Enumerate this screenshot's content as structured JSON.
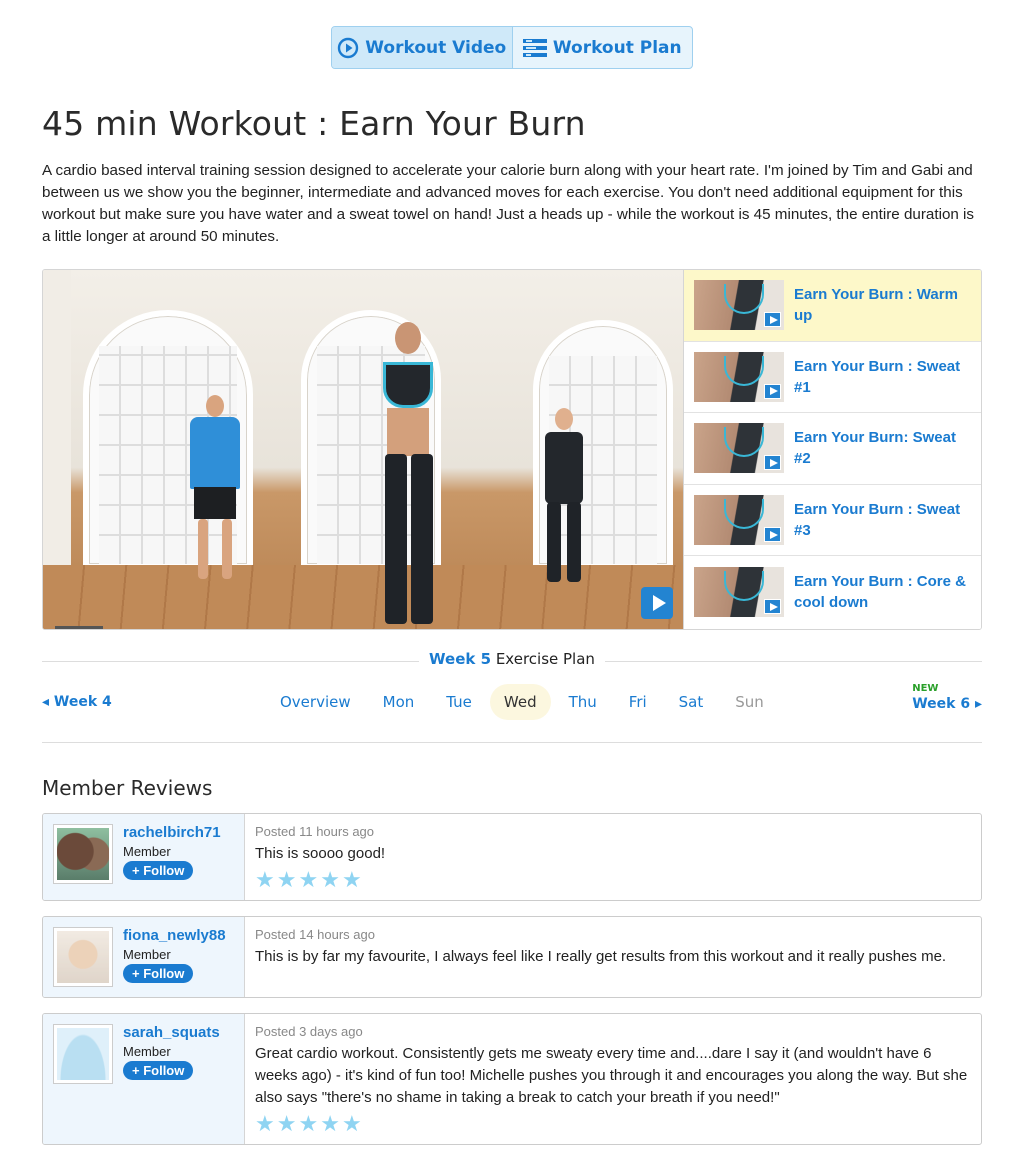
{
  "toggle": {
    "video_label": "Workout Video",
    "plan_label": "Workout Plan"
  },
  "page_title": "45 min Workout : Earn Your Burn",
  "description": "A cardio based interval training session designed to accelerate your calorie burn along with your heart rate. I'm joined by Tim and Gabi and between us we show you the beginner, intermediate and advanced moves for each exercise. You don't need additional equipment for this workout but make sure you have water and a sweat towel on hand! Just a heads up - while the workout is 45 minutes, the entire duration is a little longer at around 50 minutes.",
  "playlist": [
    {
      "title": "Earn Your Burn : Warm up",
      "active": true
    },
    {
      "title": "Earn Your Burn : Sweat #1",
      "active": false
    },
    {
      "title": "Earn Your Burn: Sweat #2",
      "active": false
    },
    {
      "title": "Earn Your Burn : Sweat #3",
      "active": false
    },
    {
      "title": "Earn Your Burn : Core & cool down",
      "active": false
    }
  ],
  "week_plan": {
    "week_label": "Week 5",
    "suffix": "Exercise Plan",
    "prev": "Week 4",
    "next": "Week 6",
    "next_badge": "NEW",
    "days": [
      "Overview",
      "Mon",
      "Tue",
      "Wed",
      "Thu",
      "Fri",
      "Sat",
      "Sun"
    ],
    "selected_day": "Wed",
    "disabled_day": "Sun"
  },
  "reviews_title": "Member Reviews",
  "reviews": [
    {
      "user": "rachelbirch71",
      "role": "Member",
      "follow": "+ Follow",
      "posted": "Posted 11 hours ago",
      "text": "This is soooo good!",
      "rating": 5
    },
    {
      "user": "fiona_newly88",
      "role": "Member",
      "follow": "+ Follow",
      "posted": "Posted 14 hours ago",
      "text": "This is by far my favourite, I always feel like I really get results from this workout and it really pushes me.",
      "rating": 0
    },
    {
      "user": "sarah_squats",
      "role": "Member",
      "follow": "+ Follow",
      "posted": "Posted 3 days ago",
      "text": "Great cardio workout. Consistently gets me sweaty every time and....dare I say it (and wouldn't have 6 weeks ago) - it's kind of fun too! Michelle pushes you through it and encourages you along the way. But she also says \"there's no shame in taking a break to catch your breath if you need!\"",
      "rating": 5
    }
  ],
  "colors": {
    "accent": "#1a7bd0",
    "star": "#8fd4f2",
    "active_item": "#fdf8c9"
  }
}
